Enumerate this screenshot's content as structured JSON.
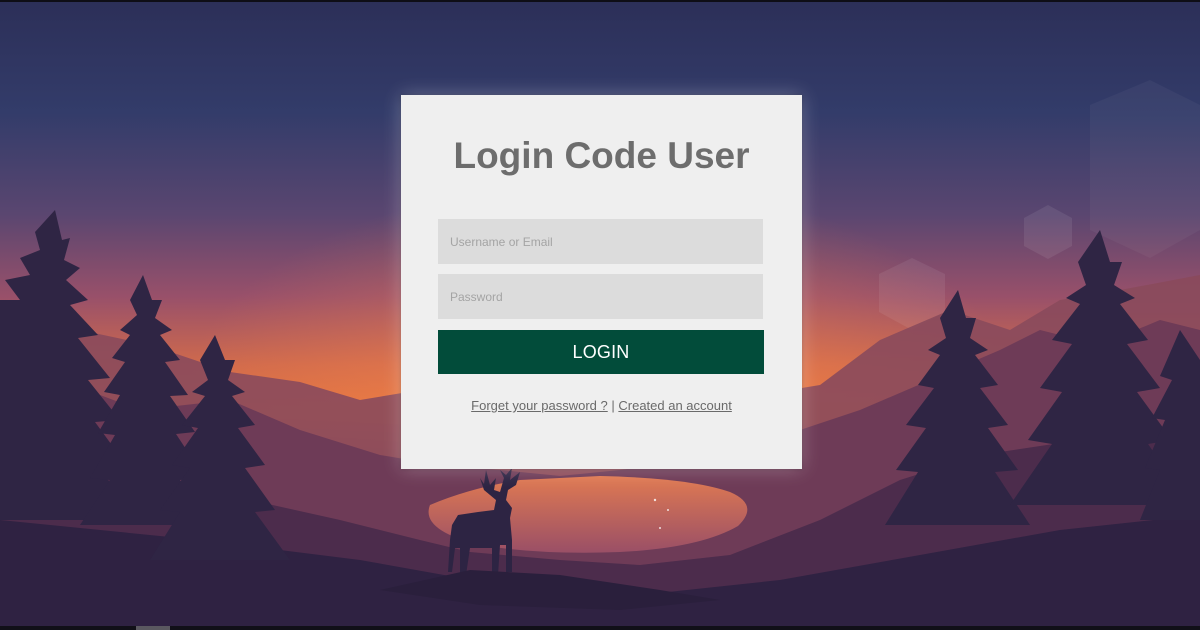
{
  "login": {
    "title": "Login Code User",
    "username_placeholder": "Username or Email",
    "password_placeholder": "Password",
    "submit_label": "LOGIN",
    "forgot_label": "Forget your password ?",
    "separator": "|",
    "create_label": "Created an account"
  },
  "colors": {
    "card_background": "#efefef",
    "field_background": "#dcdcdc",
    "button_background": "#024c3a",
    "title_color": "#6d6d6d"
  }
}
